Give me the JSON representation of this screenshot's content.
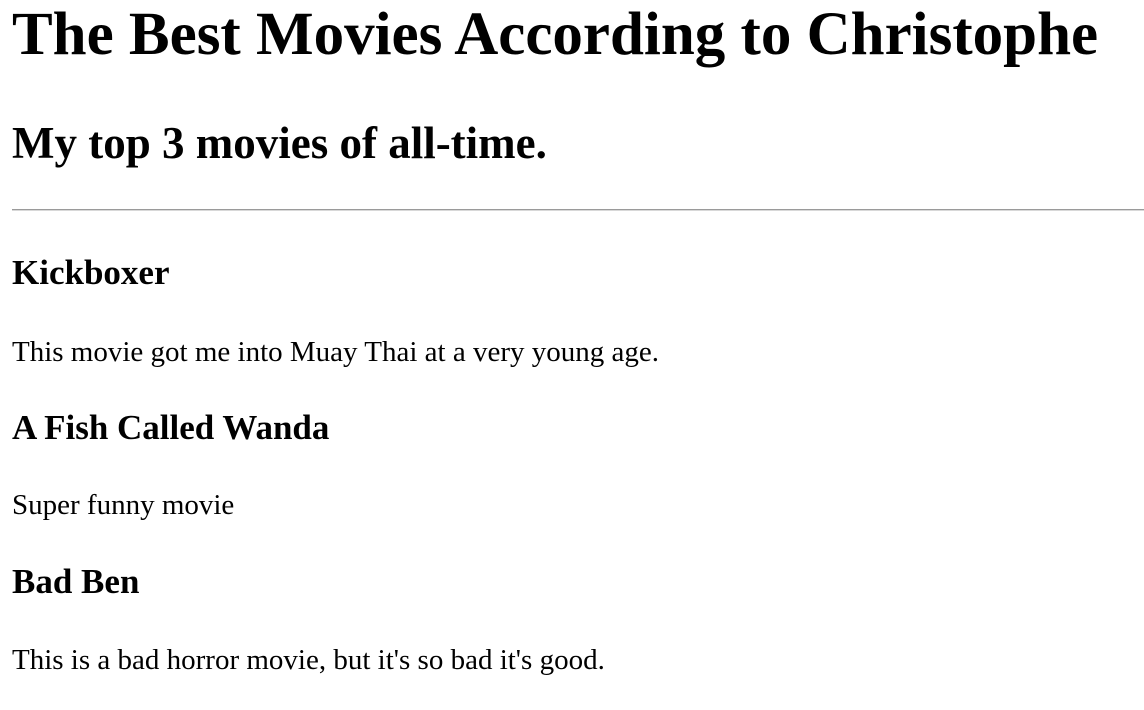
{
  "header": {
    "title": "The Best Movies According to Christophe",
    "subtitle": "My top 3 movies of all-time."
  },
  "movies": [
    {
      "title": "Kickboxer",
      "description": "This movie got me into Muay Thai at a very young age."
    },
    {
      "title": "A Fish Called Wanda",
      "description": "Super funny movie"
    },
    {
      "title": "Bad Ben",
      "description": "This is a bad horror movie, but it's so bad it's good."
    }
  ]
}
